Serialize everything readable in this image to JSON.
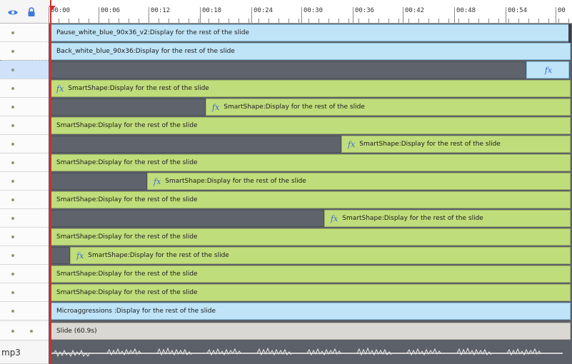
{
  "timeline": {
    "ruler_ticks": [
      "00:00",
      "00:06",
      "00:12",
      "00:18",
      "00:24",
      "00:30",
      "00:36",
      "00:42",
      "00:48",
      "00:54",
      "00"
    ],
    "audio_label": "mp3",
    "rows": [
      {
        "kind": "blue",
        "label": "Pause_white_blue_90x36_v2:Display for the rest of the slide"
      },
      {
        "kind": "blue",
        "label": "Back_white_blue_90x36:Display for the rest of the slide"
      },
      {
        "kind": "selected",
        "label": ""
      },
      {
        "kind": "green",
        "label": "SmartShape:Display for the rest of the slide"
      },
      {
        "kind": "green",
        "label": "SmartShape:Display for the rest of the slide"
      },
      {
        "kind": "green",
        "label": "SmartShape:Display for the rest of the slide"
      },
      {
        "kind": "green",
        "label": "SmartShape:Display for the rest of the slide"
      },
      {
        "kind": "green",
        "label": "SmartShape:Display for the rest of the slide"
      },
      {
        "kind": "green",
        "label": "SmartShape:Display for the rest of the slide"
      },
      {
        "kind": "green",
        "label": "SmartShape:Display for the rest of the slide"
      },
      {
        "kind": "green",
        "label": "SmartShape:Display for the rest of the slide"
      },
      {
        "kind": "green",
        "label": "SmartShape:Display for the rest of the slide"
      },
      {
        "kind": "green",
        "label": "SmartShape:Display for the rest of the slide"
      },
      {
        "kind": "green",
        "label": "SmartShape:Display for the rest of the slide"
      },
      {
        "kind": "green",
        "label": "SmartShape:Display for the rest of the slide"
      },
      {
        "kind": "blue",
        "label": "Microaggressions :Display for the rest of the slide"
      },
      {
        "kind": "slide",
        "label": "Slide (60.9s)"
      }
    ]
  },
  "fx_symbol": "fx",
  "colors": {
    "green": "#c0dd7b",
    "blue": "#bfe4f8",
    "gray": "#5f636b",
    "slide": "#dad8d2",
    "playhead": "#d72c2c"
  }
}
